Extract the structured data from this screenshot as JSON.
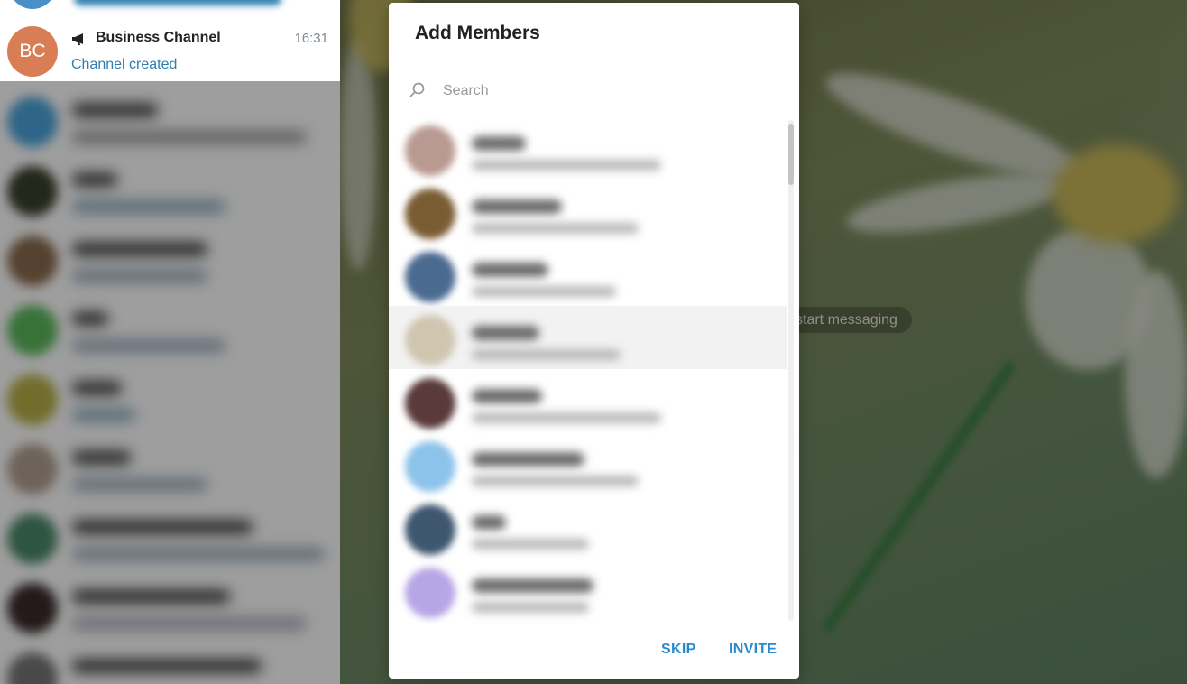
{
  "sidebar": {
    "pinned_fragment": "",
    "business_channel": {
      "initials": "BC",
      "name": "Business Channel",
      "subtitle": "Channel created",
      "time": "16:31",
      "avatar_color": "#d97d55"
    }
  },
  "chat": {
    "empty_hint": "start messaging"
  },
  "dialog": {
    "title": "Add Members",
    "search_placeholder": "Search",
    "skip_label": "SKIP",
    "invite_label": "INVITE",
    "accent_color": "#2a8bd0"
  },
  "icons": {
    "search": "search-icon",
    "channel": "megaphone-icon",
    "pin": "pin-icon"
  }
}
